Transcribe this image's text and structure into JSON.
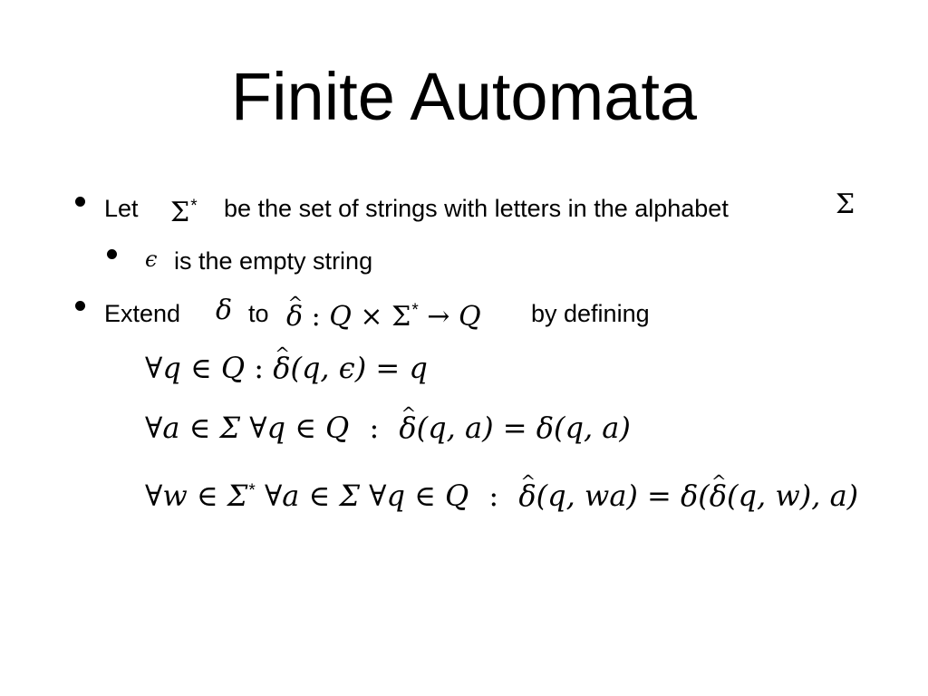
{
  "slide": {
    "title": "Finite Automata",
    "bullets": [
      {
        "level": 1,
        "prefix": "Let",
        "math1": "Σ",
        "math1_sup": "*",
        "text": "be the set of strings with letters in the alphabet",
        "math2": "Σ"
      },
      {
        "level": 2,
        "math": "ϵ",
        "text": "is the empty string"
      },
      {
        "level": 1,
        "prefix": "Extend",
        "math1": "δ",
        "mid": "to",
        "delta_hat": "δ",
        "colon": ":",
        "Q": "Q",
        "times": "×",
        "sigma": "Σ",
        "star": "*",
        "arrow": "→",
        "Q2": "Q",
        "suffix": "by defining"
      }
    ],
    "equations": [
      {
        "quantifiers": "∀q ∈ Q",
        "sep": ":",
        "lhs_func": "δ",
        "lhs_args": "(q, ϵ)",
        "eq": "=",
        "rhs": "q"
      },
      {
        "quantifiers": "∀a ∈ Σ ∀q ∈ Q",
        "sep": ":",
        "lhs_func": "δ",
        "lhs_args": "(q, a)",
        "eq": "=",
        "rhs": "δ(q, a)"
      },
      {
        "quantifiers_a": "∀w ∈ Σ",
        "quantifiers_sup": "*",
        "quantifiers_b": "∀a ∈ Σ ∀q ∈ Q",
        "sep": ":",
        "lhs_func": "δ",
        "lhs_args": "(q, wa)",
        "eq": "=",
        "rhs_a": "δ(",
        "rhs_hat": "δ",
        "rhs_b": "(q, w), a)"
      }
    ]
  }
}
